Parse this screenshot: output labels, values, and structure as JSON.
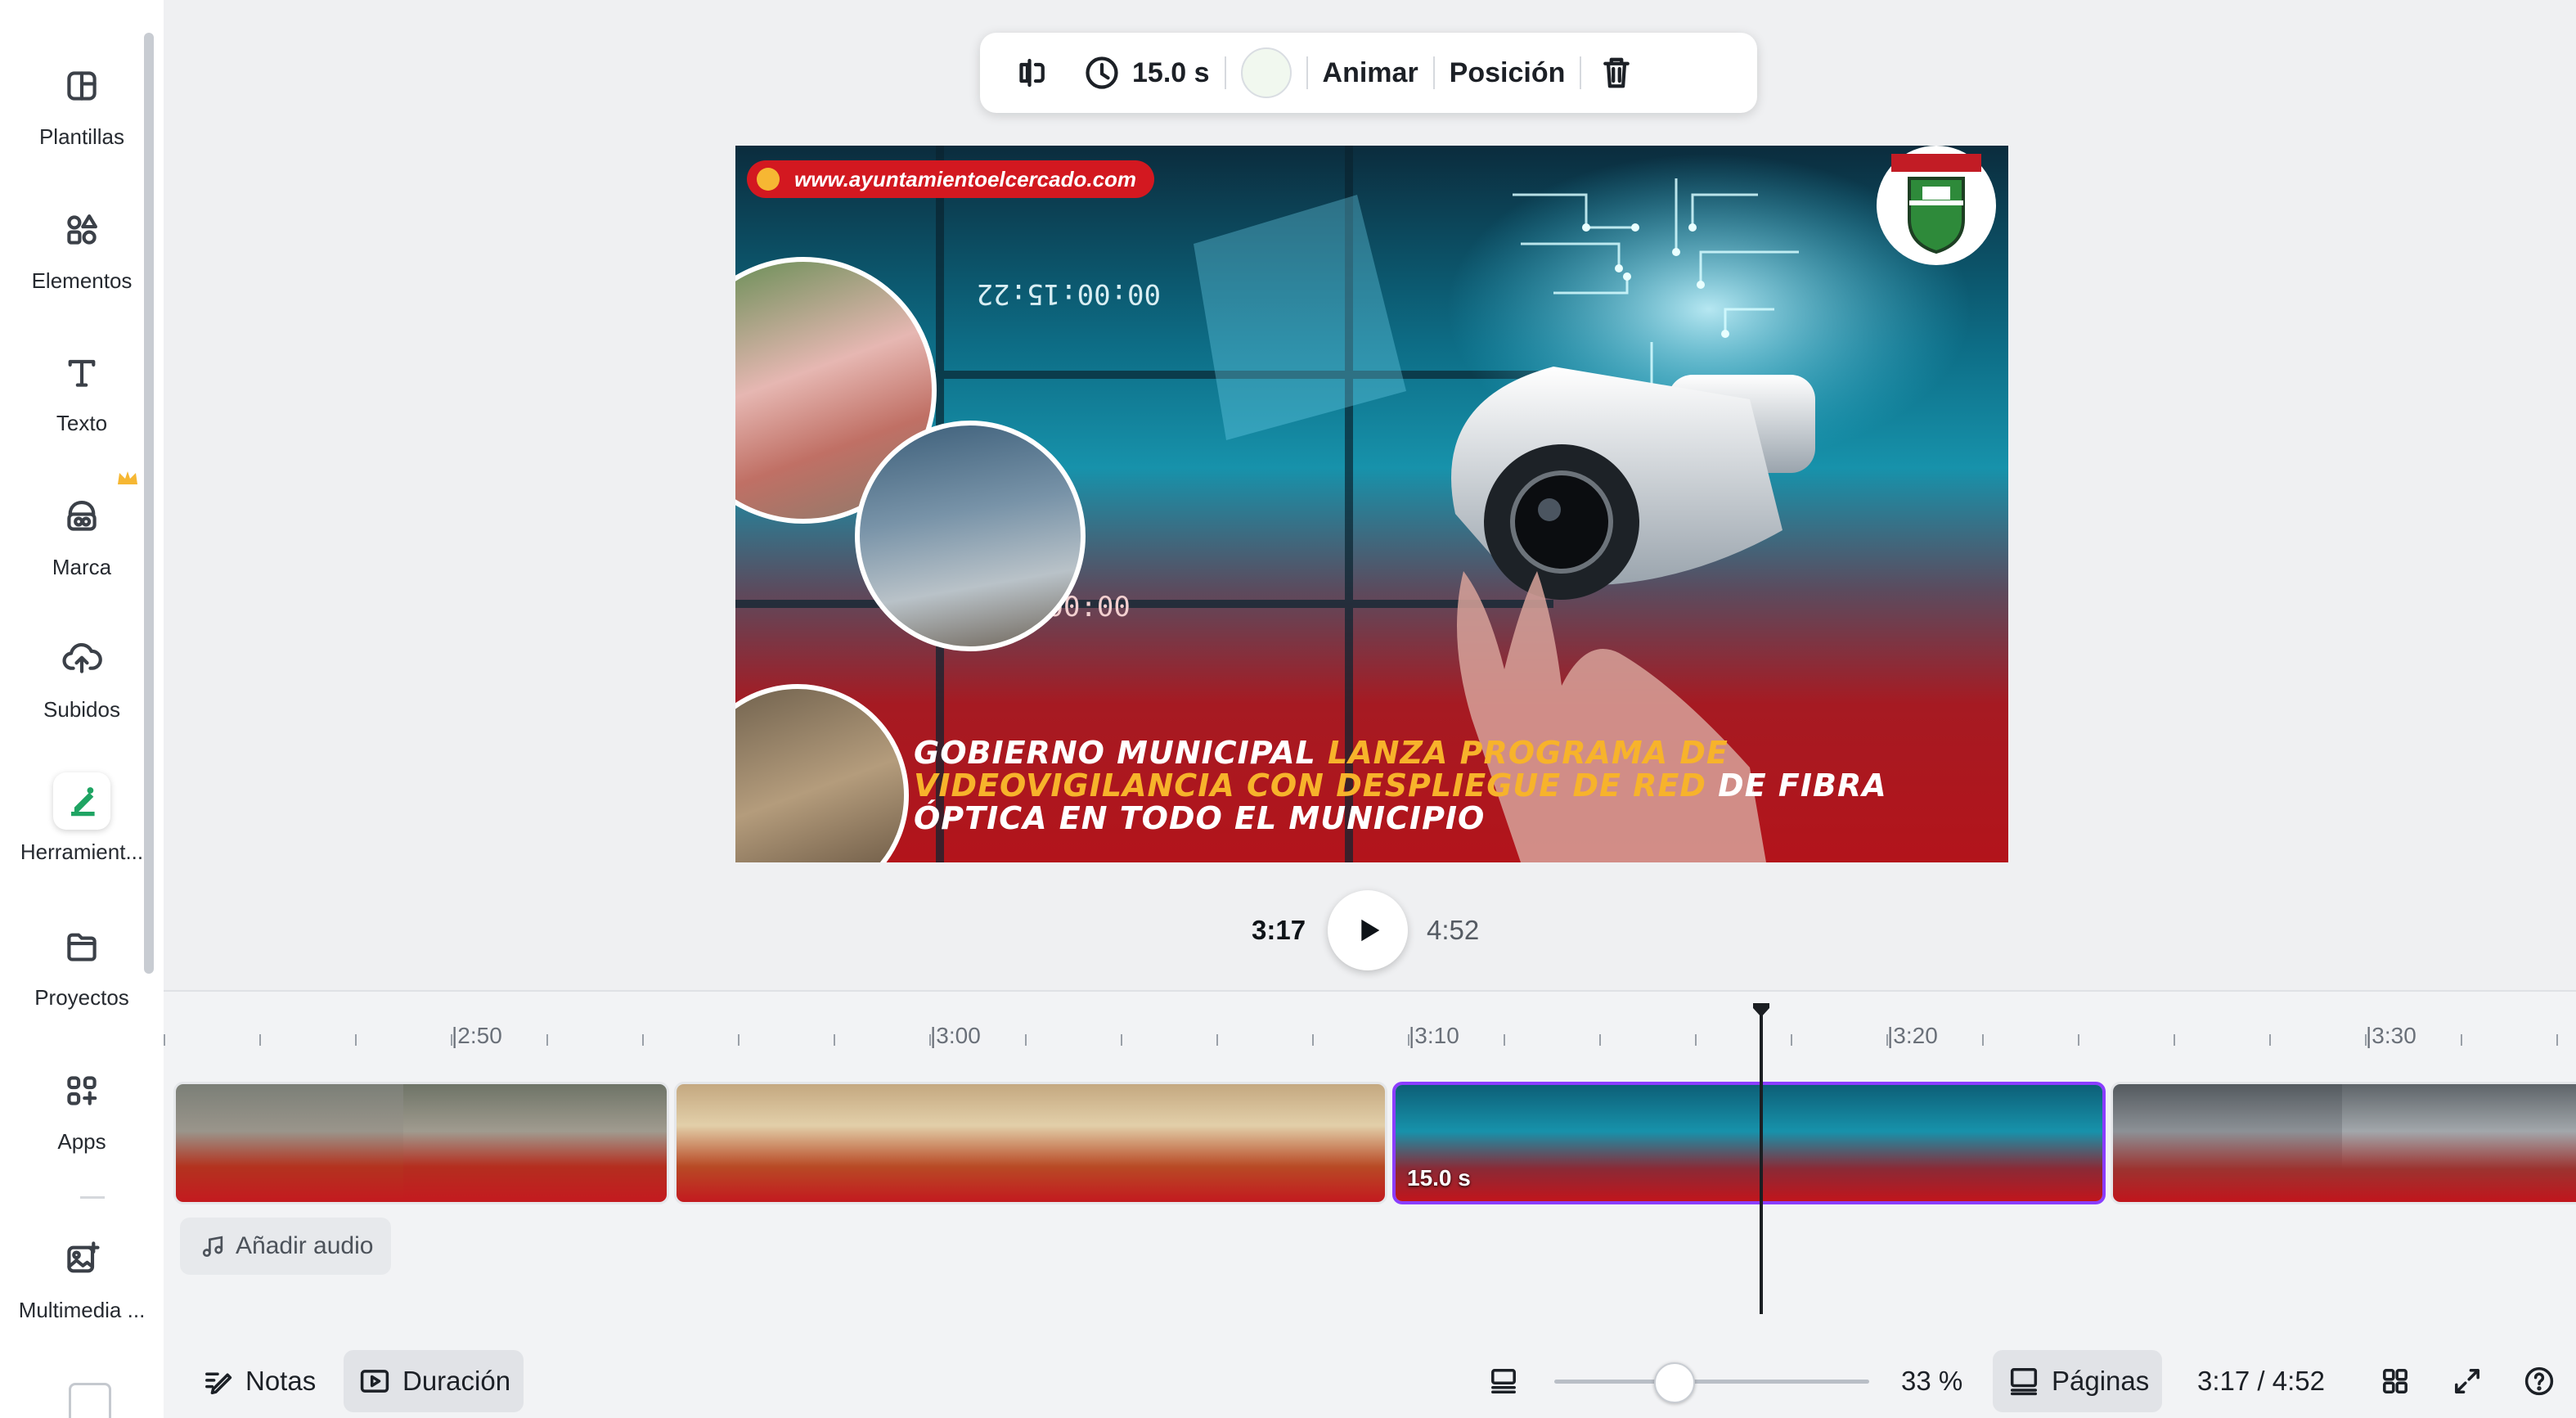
{
  "sidebar": {
    "items": [
      {
        "label": "Plantillas",
        "icon": "templates-icon"
      },
      {
        "label": "Elementos",
        "icon": "elements-icon"
      },
      {
        "label": "Texto",
        "icon": "text-icon"
      },
      {
        "label": "Marca",
        "icon": "brand-icon"
      },
      {
        "label": "Subidos",
        "icon": "upload-cloud-icon"
      },
      {
        "label": "Herramient...",
        "icon": "tools-icon"
      },
      {
        "label": "Proyectos",
        "icon": "folder-icon"
      },
      {
        "label": "Apps",
        "icon": "apps-icon"
      },
      {
        "label": "Multimedia ...",
        "icon": "media-icon"
      }
    ]
  },
  "toolbar": {
    "duration": "15.0 s",
    "animate_label": "Animar",
    "position_label": "Posición",
    "swatch_color": "#f1f8ef"
  },
  "design": {
    "url": "www.ayuntamientoelcercado.com",
    "headline_white_1": "GOBIERNO MUNICIPAL ",
    "headline_gold": "LANZA PROGRAMA DE VIDEOVIGILANCIA CON DESPLIEGUE DE RED",
    "headline_white_2": " DE FIBRA ÓPTICA EN TODO EL MUNICIPIO",
    "screen_time_1": "00:00:15:22",
    "screen_time_2": ":00:00"
  },
  "playback": {
    "current": "3:17",
    "total": "4:52"
  },
  "timeline": {
    "ticks": [
      "2:50",
      "3:00",
      "3:10",
      "3:20",
      "3:30"
    ],
    "selected_clip_duration": "15.0 s",
    "add_audio_label": "Añadir audio"
  },
  "bottombar": {
    "notes_label": "Notas",
    "duration_label": "Duración",
    "zoom": "33 %",
    "pages_label": "Páginas",
    "time_readout": "3:17 / 4:52"
  },
  "colors": {
    "accent": "#8b3dff",
    "design_red": "#b3141b",
    "design_teal": "#1792ab",
    "headline_gold": "#f7b32b"
  }
}
